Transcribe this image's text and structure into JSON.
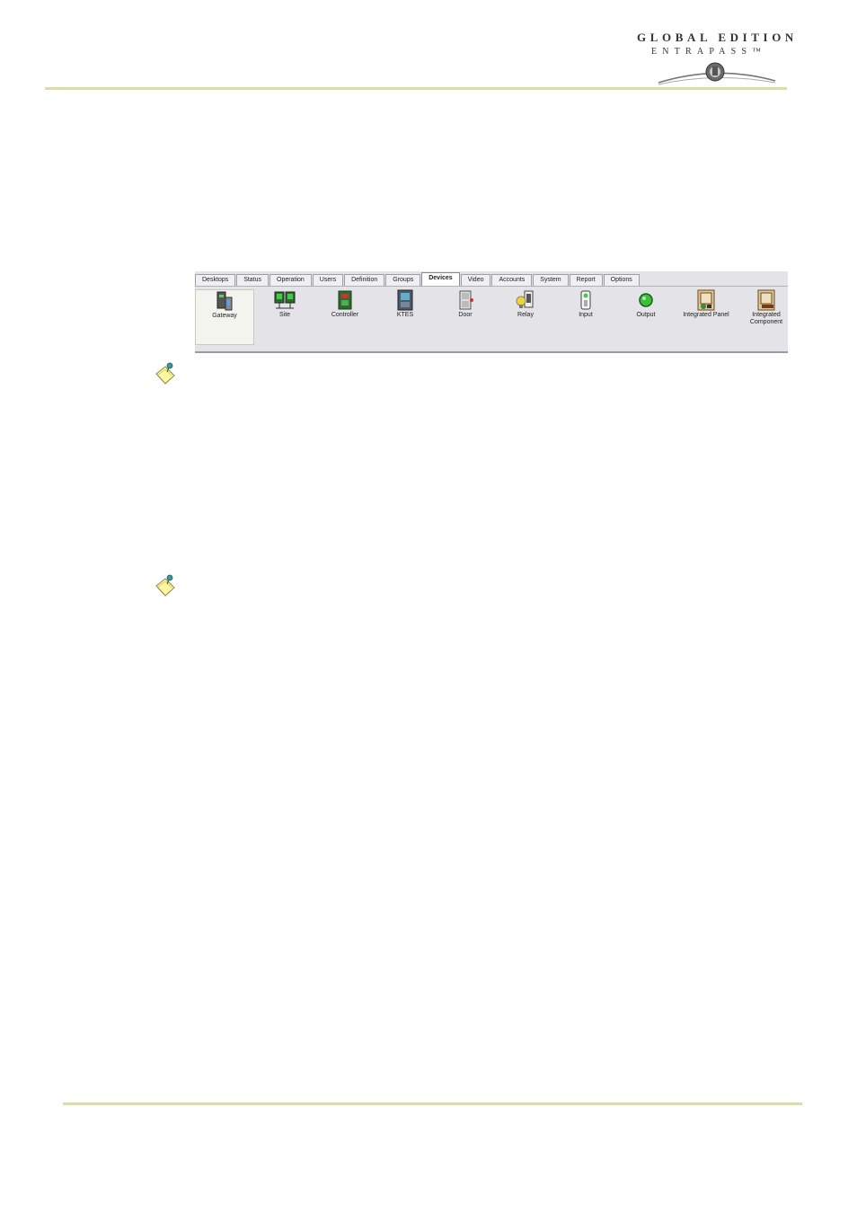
{
  "logo": {
    "line1": "GLOBAL EDITION",
    "line2": "ENTRAPASS™"
  },
  "toolbar": {
    "tabs": [
      {
        "label": "Desktops"
      },
      {
        "label": "Status"
      },
      {
        "label": "Operation"
      },
      {
        "label": "Users"
      },
      {
        "label": "Definition"
      },
      {
        "label": "Groups"
      },
      {
        "label": "Devices",
        "active": true
      },
      {
        "label": "Video"
      },
      {
        "label": "Accounts"
      },
      {
        "label": "System"
      },
      {
        "label": "Report"
      },
      {
        "label": "Options"
      }
    ],
    "items": [
      {
        "label": "Gateway",
        "icon": "gateway-icon"
      },
      {
        "label": "Site",
        "icon": "site-icon"
      },
      {
        "label": "Controller",
        "icon": "controller-icon"
      },
      {
        "label": "KTES",
        "icon": "ktes-icon"
      },
      {
        "label": "Door",
        "icon": "door-icon"
      },
      {
        "label": "Relay",
        "icon": "relay-icon"
      },
      {
        "label": "Input",
        "icon": "input-icon"
      },
      {
        "label": "Output",
        "icon": "output-icon"
      },
      {
        "label": "Integrated Panel",
        "icon": "integrated-panel-icon"
      },
      {
        "label": "Integrated Component",
        "icon": "integrated-component-icon"
      }
    ]
  }
}
